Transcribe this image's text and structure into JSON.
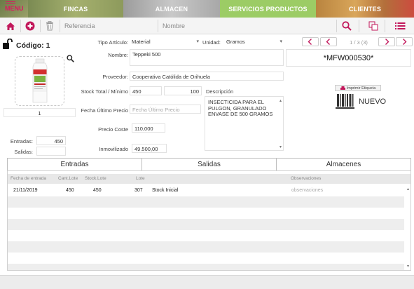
{
  "nav": {
    "menu_label": "MENU",
    "tabs": [
      {
        "label": "FINCAS"
      },
      {
        "label": "ALMACEN"
      },
      {
        "label": "SERVICIOS PRODUCTOS"
      },
      {
        "label": "CLIENTES"
      }
    ]
  },
  "toolbar": {
    "referencia_placeholder": "Referencia",
    "nombre_placeholder": "Nombre"
  },
  "record": {
    "codigo_label": "Código: 1",
    "image_caption": "1",
    "pager": "1 / 3 (3)",
    "barcode_text": "*MFW000530*",
    "print_label": "Imprimir Etiqueta",
    "nuevo_label": "NUEVO"
  },
  "form": {
    "tipo_articulo_label": "Tipo Artículo:",
    "tipo_articulo_value": "Material",
    "unidad_label": "Unidad:",
    "unidad_value": "Gramos",
    "nombre_label": "Nombre:",
    "nombre_value": "Teppeki 500",
    "proveedor_label": "Proveedor:",
    "proveedor_value": "Cooperativa Católida de Orihuela",
    "stock_label": "Stock Total / Mínimo",
    "stock_total": "450",
    "stock_minimo": "100",
    "descripcion_label": "Descripción",
    "descripcion_value": "INSECTICIDA PARA EL PULGON, GRANULADO ENVASE DE 500 GRAMOS",
    "fecha_ultimo_label": "Fecha Último Precio",
    "fecha_ultimo_placeholder": "Fecha Último Precio",
    "precio_coste_label": "Precio Coste",
    "precio_coste_value": "110,000",
    "inmovilizado_label": "Inmovilizado",
    "inmovilizado_value": "49.500,00",
    "entradas_label": "Entradas:",
    "entradas_value": "450",
    "salidas_label": "Salidas:",
    "salidas_value": ""
  },
  "tabs": [
    {
      "label": "Entradas"
    },
    {
      "label": "Salidas"
    },
    {
      "label": "Almacenes"
    }
  ],
  "grid": {
    "columns": {
      "fecha": "Fecha de entrada",
      "cant_lote": "Cant.Lote",
      "stock_lote": "Stock.Lote",
      "lote": "Lote",
      "observaciones": "Observaciones"
    },
    "rows": [
      {
        "fecha": "21/11/2019",
        "cant_lote": "450",
        "stock_lote": "450",
        "lote": "307",
        "origen": "Stock Inicial",
        "observaciones": "observaciones"
      }
    ]
  },
  "colors": {
    "accent": "#c2185b",
    "servicios_tab": "#9ccc65"
  }
}
